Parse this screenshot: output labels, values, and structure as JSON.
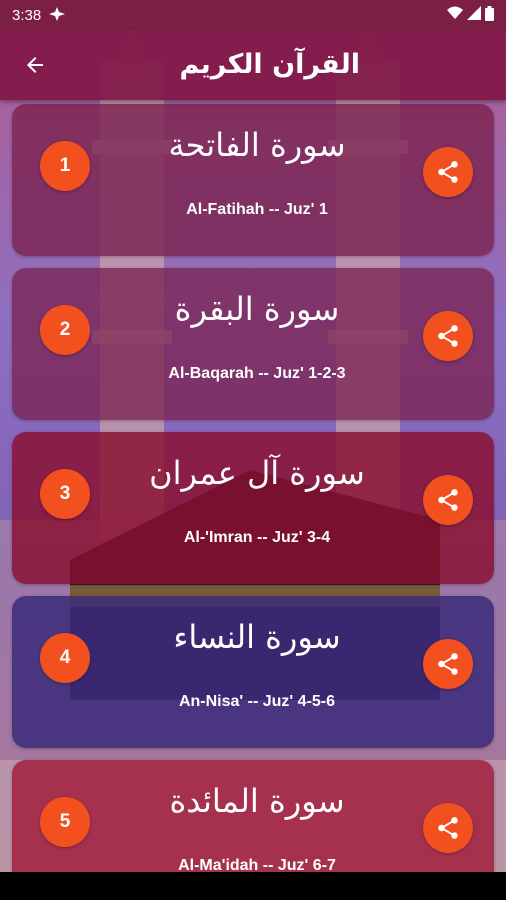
{
  "status_bar": {
    "time": "3:38",
    "left_icon": "airplane-notification-icon",
    "icons": [
      "wifi-icon",
      "signal-icon",
      "battery-icon"
    ]
  },
  "app_bar": {
    "title": "القرآن الكريم",
    "back_icon": "arrow-left-icon"
  },
  "colors": {
    "app_bar": "#801846",
    "badge": "#f2501e",
    "card_plum": "#7a2452",
    "card_indigo": "#3b2a7a",
    "card_crimson": "#8a0f2e"
  },
  "surahs": [
    {
      "number": "1",
      "arabic": "سورة الفاتحة",
      "english": "Al-Fatihah -- Juz' 1"
    },
    {
      "number": "2",
      "arabic": "سورة البقرة",
      "english": "Al-Baqarah -- Juz' 1-2-3"
    },
    {
      "number": "3",
      "arabic": "سورة آل عمران",
      "english": "Al-'Imran -- Juz' 3-4"
    },
    {
      "number": "4",
      "arabic": "سورة النساء",
      "english": "An-Nisa' -- Juz' 4-5-6"
    },
    {
      "number": "5",
      "arabic": "سورة المائدة",
      "english": "Al-Ma'idah -- Juz' 6-7"
    }
  ]
}
